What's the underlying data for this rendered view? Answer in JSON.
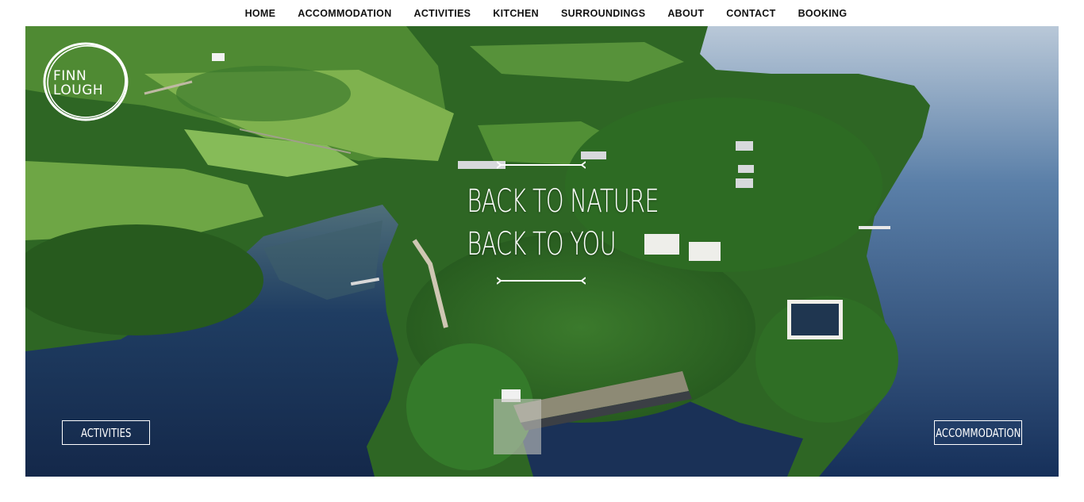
{
  "nav": {
    "items": [
      {
        "label": "HOME"
      },
      {
        "label": "ACCOMMODATION"
      },
      {
        "label": "ACTIVITIES"
      },
      {
        "label": "KITCHEN"
      },
      {
        "label": "SURROUNDINGS"
      },
      {
        "label": "ABOUT"
      },
      {
        "label": "CONTACT"
      },
      {
        "label": "BOOKING"
      }
    ]
  },
  "logo": {
    "line1": "FINN",
    "line2": "LOUGH"
  },
  "hero": {
    "image": "aerial-lake-forest-photo",
    "tagline_line1": "BACK TO NATURE",
    "tagline_line2": "BACK TO YOU",
    "left_button": "ACTIVITIES",
    "right_button": "ACCOMMODATION"
  },
  "colors": {
    "nav_text": "#111111",
    "overlay_text": "#ffffff",
    "lake": "#1d3b66",
    "forest": "#2f6b26",
    "field": "#6aa544"
  }
}
